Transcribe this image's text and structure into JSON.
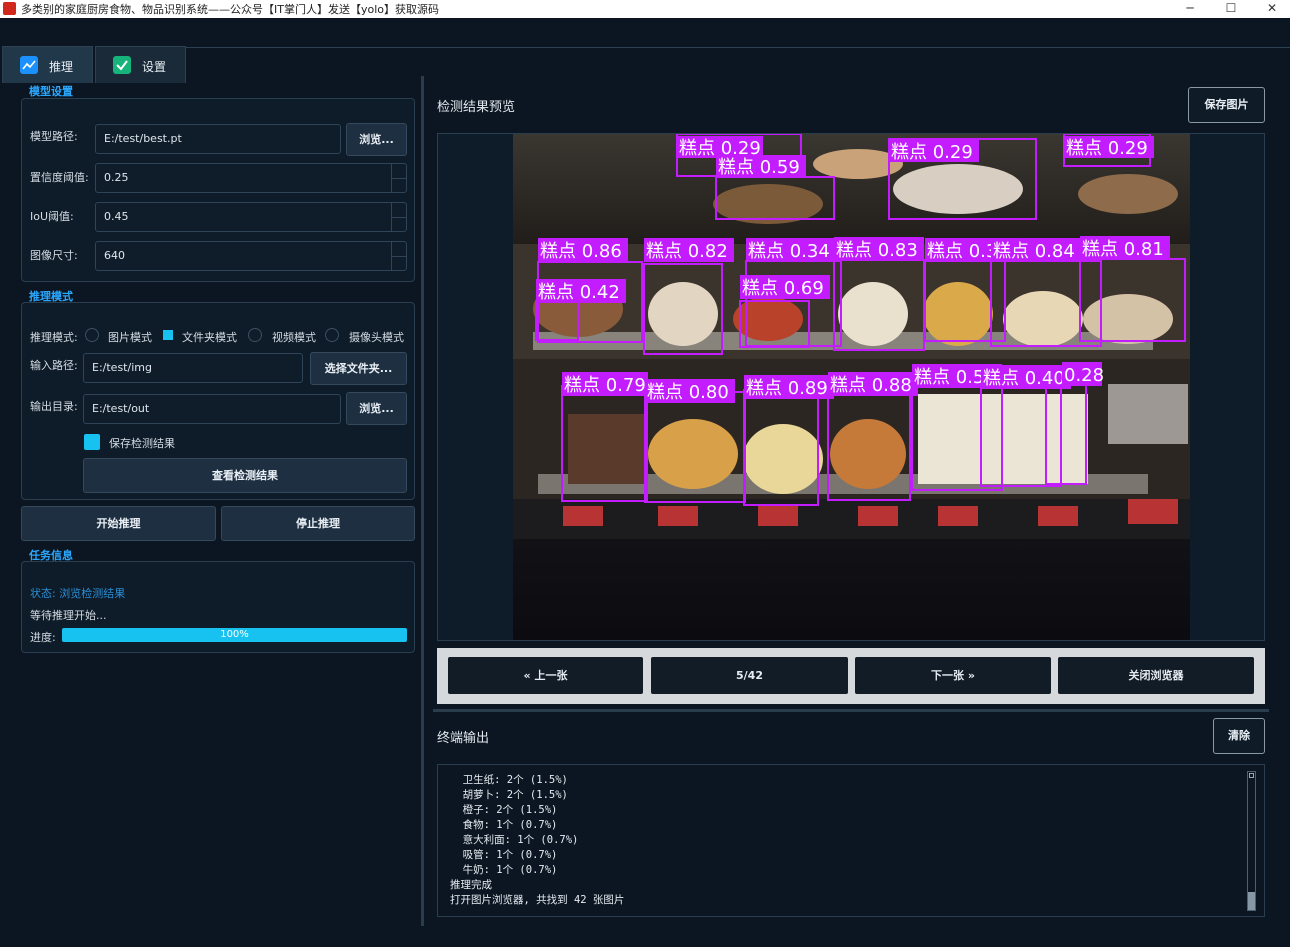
{
  "window": {
    "title": "多类别的家庭厨房食物、物品识别系统——公众号【IT掌门人】发送【yolo】获取源码",
    "minimize": "─",
    "maximize": "☐",
    "close": "✕"
  },
  "tabs": [
    {
      "label": "推理",
      "icon": "chart-icon",
      "active": true
    },
    {
      "label": "设置",
      "icon": "check-icon",
      "active": false
    }
  ],
  "model_settings": {
    "section_title": "模型设置",
    "model_path_label": "模型路径:",
    "model_path_value": "E:/test/best.pt",
    "browse_label": "浏览...",
    "conf_label": "置信度阈值:",
    "conf_value": "0.25",
    "iou_label": "IoU阈值:",
    "iou_value": "0.45",
    "img_size_label": "图像尺寸:",
    "img_size_value": "640"
  },
  "infer_mode": {
    "section_title": "推理模式",
    "mode_label": "推理模式:",
    "modes": [
      "图片模式",
      "文件夹模式",
      "视频模式",
      "摄像头模式"
    ],
    "selected_mode": "文件夹模式",
    "input_path_label": "输入路径:",
    "input_path_value": "E:/test/img",
    "select_folder_label": "选择文件夹...",
    "output_dir_label": "输出目录:",
    "output_dir_value": "E:/test/out",
    "browse_label": "浏览...",
    "save_results_label": "保存检测结果",
    "view_results_label": "查看检测结果"
  },
  "actions": {
    "start_label": "开始推理",
    "stop_label": "停止推理"
  },
  "task_info": {
    "section_title": "任务信息",
    "status_text": "状态: 浏览检测结果",
    "waiting_text": "等待推理开始...",
    "progress_label": "进度:",
    "progress_value": 100,
    "progress_text": "100%"
  },
  "preview": {
    "title": "检测结果预览",
    "save_image_label": "保存图片",
    "detections": [
      {
        "label": "糕点 0.29"
      },
      {
        "label": "糕点 0.59"
      },
      {
        "label": "糕点 0.29"
      },
      {
        "label": "糕点 0.29"
      },
      {
        "label": "糕点 0.86"
      },
      {
        "label": "糕点 0.82"
      },
      {
        "label": "糕点 0.34"
      },
      {
        "label": "糕点 0.83"
      },
      {
        "label": "糕点 0.3"
      },
      {
        "label": "糕点 0.84"
      },
      {
        "label": "糕点 0.81"
      },
      {
        "label": "糕点 0.42"
      },
      {
        "label": "糕点 0.69"
      },
      {
        "label": "糕点 0.79"
      },
      {
        "label": "糕点 0.80"
      },
      {
        "label": "糕点 0.89"
      },
      {
        "label": "糕点 0.88"
      },
      {
        "label": "糕点 0.52"
      },
      {
        "label": "糕点 0.40"
      },
      {
        "label": "0.28"
      }
    ]
  },
  "navigation": {
    "prev_label": "« 上一张",
    "counter": "5/42",
    "next_label": "下一张 »",
    "close_browser_label": "关闭浏览器"
  },
  "terminal": {
    "title": "终端输出",
    "clear_label": "清除",
    "lines": [
      "  卫生纸: 2个 (1.5%)",
      "  胡萝卜: 2个 (1.5%)",
      "  橙子: 2个 (1.5%)",
      "  食物: 1个 (0.7%)",
      "  意大利面: 1个 (0.7%)",
      "  吸管: 1个 (0.7%)",
      "  牛奶: 1个 (0.7%)",
      "推理完成",
      "打开图片浏览器, 共找到 42 张图片"
    ]
  },
  "colors": {
    "accent": "#18c2f0",
    "section_title": "#2aa8ff",
    "detection_box": "#c31dff",
    "background": "#0b1622"
  }
}
